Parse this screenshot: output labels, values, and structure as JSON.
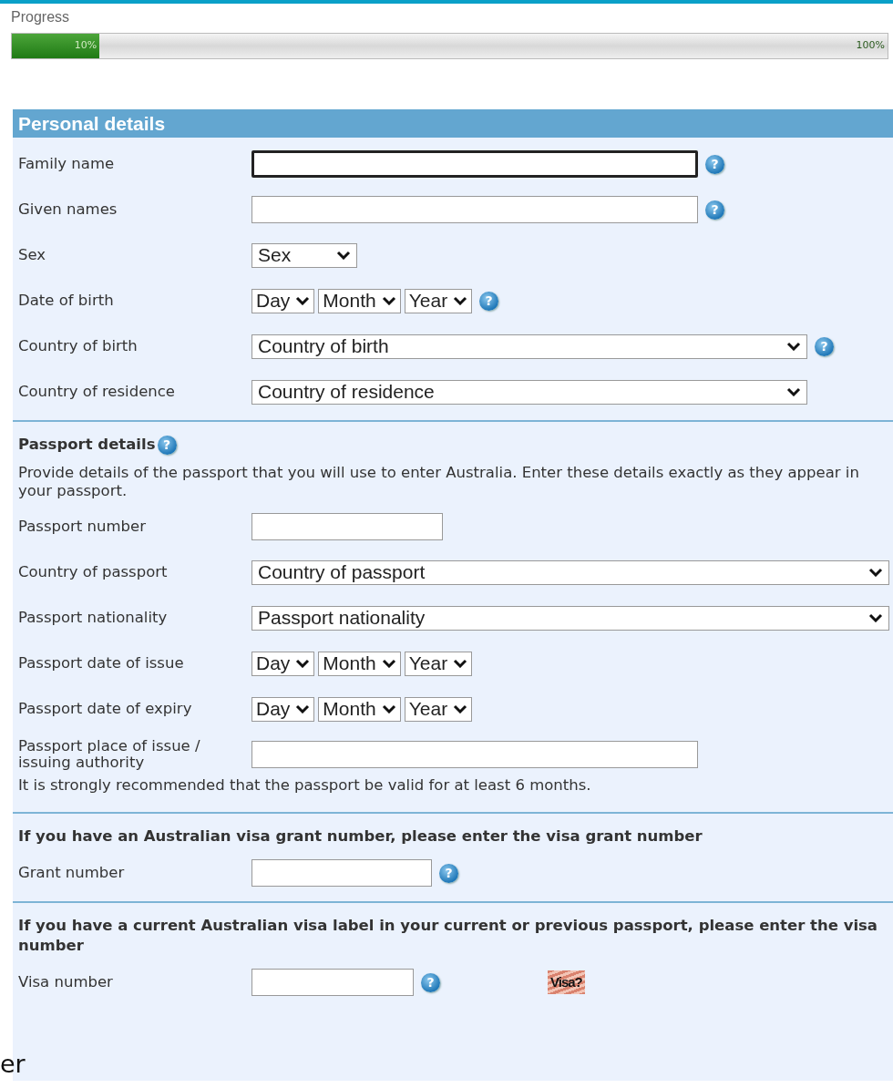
{
  "progress": {
    "label": "Progress",
    "level": 0.1,
    "current_label": "10%",
    "end_label": "100%"
  },
  "panel_title": "Personal details",
  "sections": [
    {
      "fields": [
        {
          "label": "Family name",
          "kind": "text",
          "focused": true,
          "help": "?"
        },
        {
          "label": "Given names",
          "kind": "text",
          "focused": false,
          "help": "?"
        },
        {
          "label": "Sex",
          "kind": "select",
          "value": "Sex"
        },
        {
          "label": "Date of birth",
          "kind": "date",
          "parts": [
            "Day",
            "Month",
            "Year"
          ],
          "help": "?"
        },
        {
          "label": "Country of birth",
          "kind": "select",
          "value": "Country of birth",
          "help": "?"
        },
        {
          "label": "Country of residence",
          "kind": "select",
          "value": "Country of residence"
        }
      ]
    },
    {
      "heading": "Passport details",
      "heading_help": "?",
      "intro": "Provide details of the passport that you will use to enter Australia. Enter these details exactly as they appear in your passport.",
      "fields": [
        {
          "label": "Passport number",
          "kind": "text",
          "focused": false
        },
        {
          "label": "Country of passport",
          "kind": "select",
          "value": "Country of passport"
        },
        {
          "label": "Passport nationality",
          "kind": "select",
          "value": "Passport nationality"
        },
        {
          "label": "Passport date of issue",
          "kind": "date",
          "parts": [
            "Day",
            "Month",
            "Year"
          ]
        },
        {
          "label": "Passport date of expiry",
          "kind": "date",
          "parts": [
            "Day",
            "Month",
            "Year"
          ]
        },
        {
          "label": "Passport place of issue / issuing authority",
          "kind": "text",
          "focused": false
        }
      ],
      "note": "It is strongly recommended that the passport be valid for at least 6 months."
    },
    {
      "heading": "If you have an Australian visa grant number, please enter the visa grant number",
      "fields": [
        {
          "label": "Grant number",
          "kind": "text",
          "focused": false,
          "help": "?"
        }
      ]
    },
    {
      "heading": "If you have a current Australian visa label in your current or previous passport, please enter the visa number",
      "fields": [
        {
          "label": "Visa number",
          "kind": "text",
          "focused": false,
          "help": "?",
          "sample": "Visa?"
        }
      ]
    }
  ],
  "overlay_text": "er"
}
